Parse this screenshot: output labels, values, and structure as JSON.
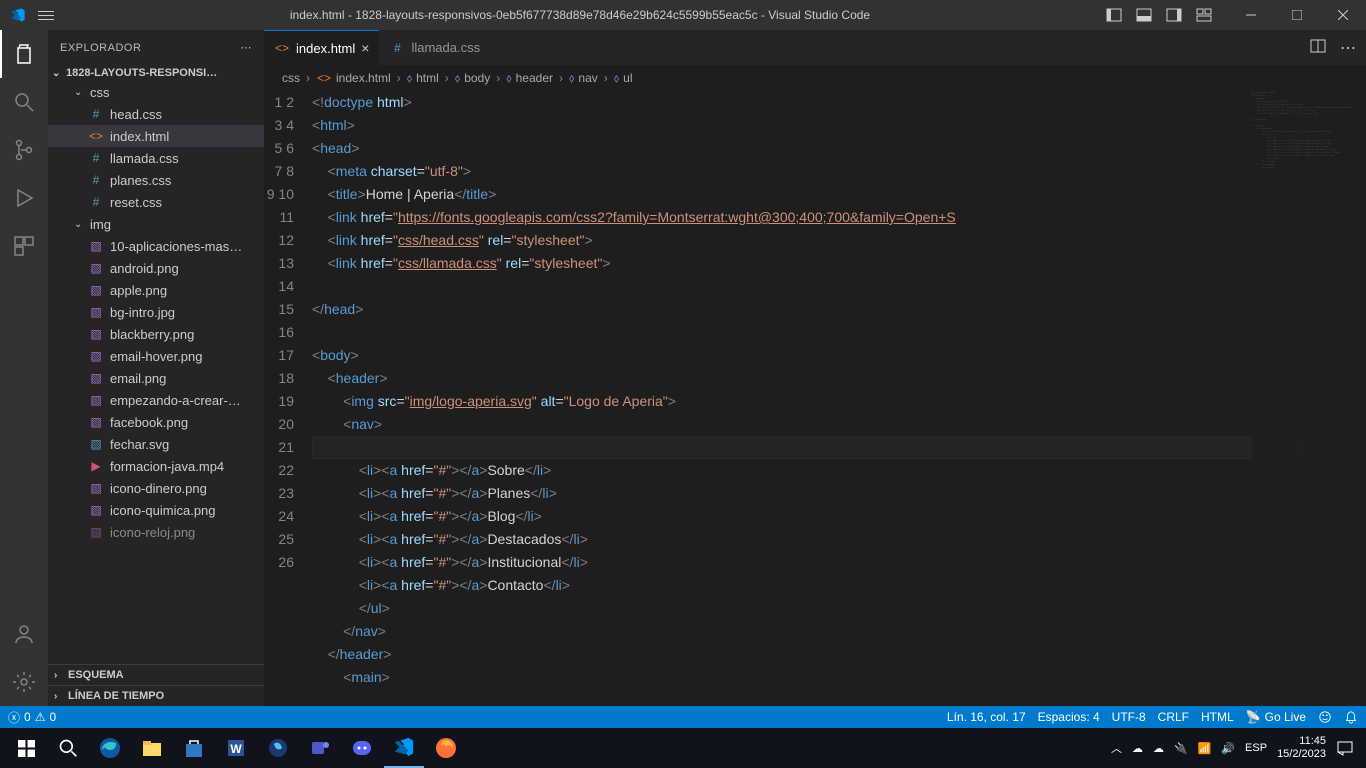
{
  "titlebar": {
    "title": "index.html - 1828-layouts-responsivos-0eb5f677738d89e78d46e29b624c5599b55eac5c - Visual Studio Code"
  },
  "sidebar": {
    "title": "EXPLORADOR",
    "folder": "1828-LAYOUTS-RESPONSI…",
    "tree": {
      "css_folder": "css",
      "head_css": "head.css",
      "index_html": "index.html",
      "llamada_css": "llamada.css",
      "planes_css": "planes.css",
      "reset_css": "reset.css",
      "img_folder": "img",
      "img_items": [
        "10-aplicaciones-mas…",
        "android.png",
        "apple.png",
        "bg-intro.jpg",
        "blackberry.png",
        "email-hover.png",
        "email.png",
        "empezando-a-crear-…",
        "facebook.png",
        "fechar.svg",
        "formacion-java.mp4",
        "icono-dinero.png",
        "icono-quimica.png",
        "icono-reloj.png"
      ]
    },
    "outline": "ESQUEMA",
    "timeline": "LÍNEA DE TIEMPO"
  },
  "tabs": {
    "active": "index.html",
    "inactive": "llamada.css"
  },
  "breadcrumb": {
    "p1": "css",
    "p2": "index.html",
    "p3": "html",
    "p4": "body",
    "p5": "header",
    "p6": "nav",
    "p7": "ul"
  },
  "code": {
    "lines": 26,
    "nav_items": [
      "Sobre",
      "Planes",
      "Blog",
      "Destacados",
      "Institucional",
      "Contacto"
    ],
    "title_text": "Home | Aperia",
    "font_url": "https://fonts.googleapis.com/css2?family=Montserrat:wght@300;400;700&family=Open+S",
    "css1": "css/head.css",
    "css2": "css/llamada.css",
    "logo_src": "img/logo-aperia.svg",
    "logo_alt": "Logo de Aperia"
  },
  "statusbar": {
    "errors": "0",
    "warnings": "0",
    "line_col": "Lín. 16, col. 17",
    "spaces": "Espacios: 4",
    "encoding": "UTF-8",
    "eol": "CRLF",
    "language": "HTML",
    "golive": "Go Live"
  },
  "taskbar": {
    "lang": "ESP",
    "time": "11:45",
    "date": "15/2/2023"
  }
}
